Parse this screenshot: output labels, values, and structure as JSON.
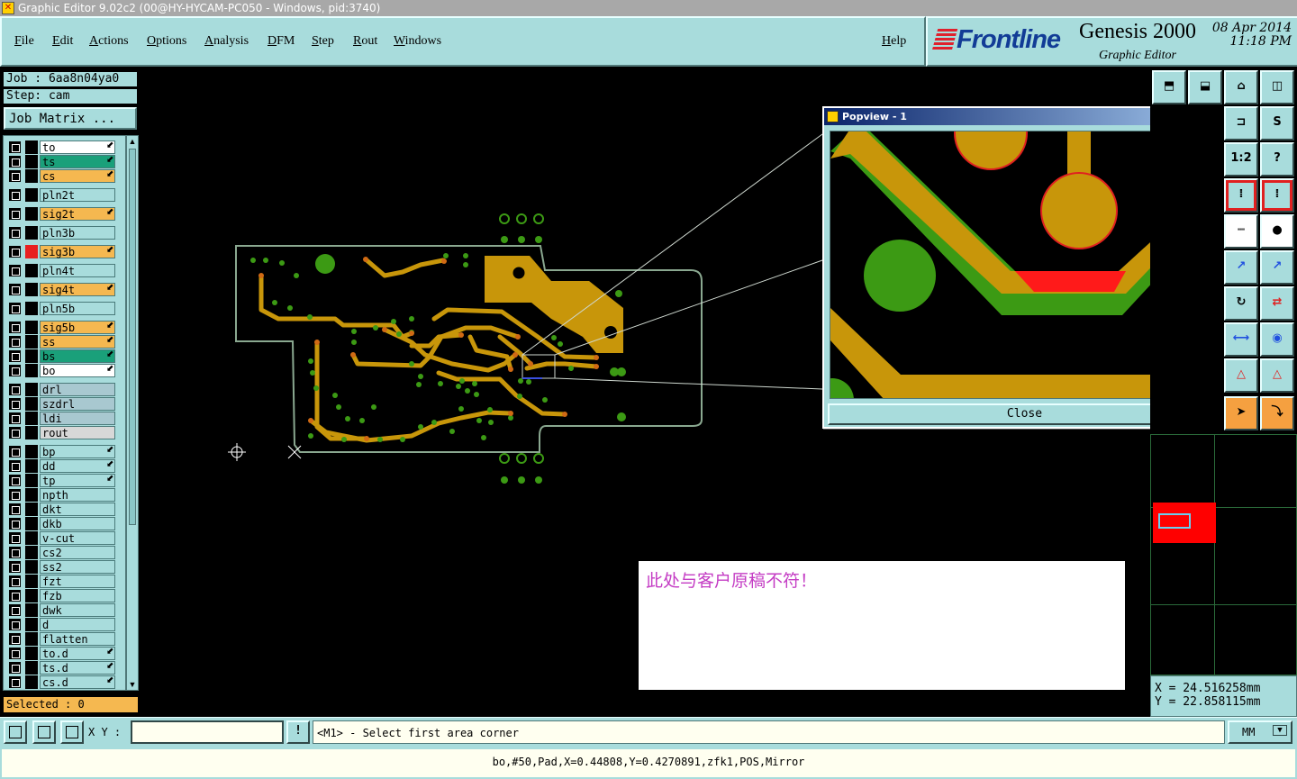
{
  "window": {
    "title": "Graphic Editor 9.02c2 (00@HY-HYCAM-PC050 - Windows, pid:3740)"
  },
  "menu": [
    "File",
    "Edit",
    "Actions",
    "Options",
    "Analysis",
    "DFM",
    "Step",
    "Rout",
    "Windows"
  ],
  "help": "Help",
  "brand": {
    "logo": "Frontline",
    "product": "Genesis 2000",
    "subtitle": "Graphic Editor",
    "date": "08 Apr 2014",
    "time": "11:18 PM"
  },
  "job": {
    "job_label": "Job : 6aa8n04ya0",
    "step_label": "Step: cam",
    "matrix_button": "Job Matrix ..."
  },
  "layers": [
    {
      "name": "to",
      "color": "white",
      "cursor": true
    },
    {
      "name": "ts",
      "color": "teal",
      "cursor": true
    },
    {
      "name": "cs",
      "color": "orange",
      "cursor": true
    },
    {
      "name": "pln2t",
      "color": "cyan",
      "cursor": false
    },
    {
      "name": "sig2t",
      "color": "orange",
      "cursor": true
    },
    {
      "name": "pln3b",
      "color": "cyan",
      "cursor": false
    },
    {
      "name": "sig3b",
      "color": "orange",
      "cursor": true,
      "marker": "red"
    },
    {
      "name": "pln4t",
      "color": "cyan",
      "cursor": false
    },
    {
      "name": "sig4t",
      "color": "orange",
      "cursor": true
    },
    {
      "name": "pln5b",
      "color": "cyan",
      "cursor": false
    },
    {
      "name": "sig5b",
      "color": "orange",
      "cursor": true
    },
    {
      "name": "ss",
      "color": "orange",
      "cursor": true
    },
    {
      "name": "bs",
      "color": "teal",
      "cursor": true
    },
    {
      "name": "bo",
      "color": "white",
      "cursor": true
    },
    {
      "name": "drl",
      "color": "gray",
      "cursor": false
    },
    {
      "name": "szdrl",
      "color": "gray",
      "cursor": false
    },
    {
      "name": "ldi",
      "color": "gray",
      "cursor": false
    },
    {
      "name": "rout",
      "color": "lgray",
      "cursor": false
    },
    {
      "name": "bp",
      "color": "cyan",
      "cursor": true
    },
    {
      "name": "dd",
      "color": "cyan",
      "cursor": true
    },
    {
      "name": "tp",
      "color": "cyan",
      "cursor": true
    },
    {
      "name": "npth",
      "color": "cyan",
      "cursor": false
    },
    {
      "name": "dkt",
      "color": "cyan",
      "cursor": false
    },
    {
      "name": "dkb",
      "color": "cyan",
      "cursor": false
    },
    {
      "name": "v-cut",
      "color": "cyan",
      "cursor": false
    },
    {
      "name": "cs2",
      "color": "cyan",
      "cursor": false
    },
    {
      "name": "ss2",
      "color": "cyan",
      "cursor": false
    },
    {
      "name": "fzt",
      "color": "cyan",
      "cursor": false
    },
    {
      "name": "fzb",
      "color": "cyan",
      "cursor": false
    },
    {
      "name": "dwk",
      "color": "cyan",
      "cursor": false
    },
    {
      "name": "d",
      "color": "cyan",
      "cursor": false
    },
    {
      "name": "flatten",
      "color": "cyan",
      "cursor": false
    },
    {
      "name": "to.d",
      "color": "cyan",
      "cursor": true
    },
    {
      "name": "ts.d",
      "color": "cyan",
      "cursor": true
    },
    {
      "name": "cs.d",
      "color": "cyan",
      "cursor": true
    }
  ],
  "selected": "Selected : 0",
  "note": "此处与客户原稿不符！",
  "popview": {
    "title": "Popview - 1",
    "close_label": "Close",
    "close_x": "✕"
  },
  "right_tools": [
    "1:2",
    "?"
  ],
  "coords": {
    "x": "X  =  24.516258mm",
    "y": "Y  =  22.858115mm"
  },
  "status": {
    "xy_label": "X Y :",
    "bang": "!",
    "prompt": "<M1> - Select first area corner",
    "units": "MM"
  },
  "feature_info": "bo,#50,Pad,X=0.44808,Y=0.4270891,zfk1,POS,Mirror",
  "colors": {
    "panel": "#a8dcdc",
    "copper": "#c8960a",
    "pad_green": "#3c9a14",
    "outline": "#8aa890",
    "note_text": "#c43cc4"
  }
}
